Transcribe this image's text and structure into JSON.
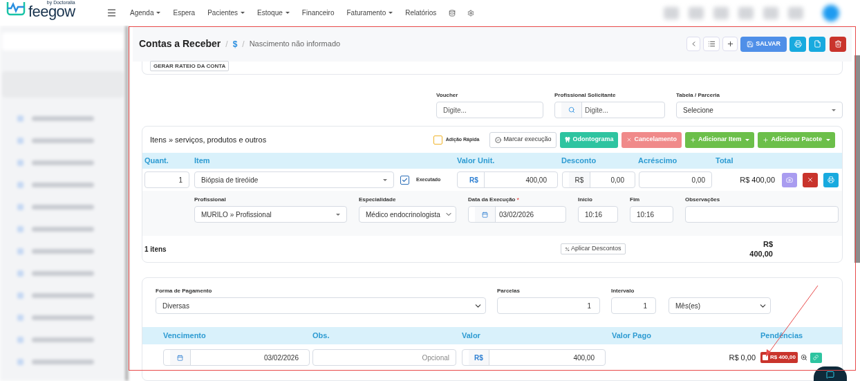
{
  "brand": {
    "name": "feegow",
    "tagline": "by Doctoralia"
  },
  "nav": [
    {
      "label": "Agenda",
      "dropdown": true
    },
    {
      "label": "Espera",
      "dropdown": false
    },
    {
      "label": "Pacientes",
      "dropdown": true
    },
    {
      "label": "Estoque",
      "dropdown": true
    },
    {
      "label": "Financeiro",
      "dropdown": false
    },
    {
      "label": "Faturamento",
      "dropdown": true
    },
    {
      "label": "Relatórios",
      "dropdown": false
    }
  ],
  "header": {
    "title": "Contas a Receber",
    "separators": [
      "/",
      "/"
    ],
    "symbol": "$",
    "subtitle": "Nascimento não informado",
    "save_label": "SALVAR"
  },
  "rateio_button": "GERAR RATEIO DA CONTA",
  "top_fields": [
    {
      "kind": "text",
      "label": "Voucher",
      "placeholder": "Digite..."
    },
    {
      "kind": "search",
      "label": "Profissional Solicitante",
      "placeholder": "Digite..."
    },
    {
      "kind": "select",
      "label": "Tabela / Parceria",
      "value": "Selecione"
    }
  ],
  "items": {
    "title": "Itens » serviços, produtos e outros",
    "quick_add": {
      "label": "Adição Rápida",
      "checked": false
    },
    "buttons": [
      {
        "kind": "outline",
        "label": "Marcar execução"
      },
      {
        "kind": "teal",
        "label": "Odontograma"
      },
      {
        "kind": "cancel",
        "label": "Cancelamento"
      },
      {
        "kind": "add",
        "label": "Adicionar Item"
      },
      {
        "kind": "add",
        "label": "Adicionar Pacote"
      }
    ],
    "columns": [
      "Quant.",
      "Item",
      "Valor Unit.",
      "Desconto",
      "Acréscimo",
      "Total"
    ],
    "rows": [
      {
        "quantity": "1",
        "item": "Biópsia de tireóide",
        "executed": {
          "label": "Executado",
          "checked": true
        },
        "currency": "R$",
        "unit_value": "400,00",
        "discount_currency": "R$",
        "discount": "0,00",
        "surcharge": "0,00",
        "total": "R$ 400,00"
      }
    ],
    "details": {
      "professional": {
        "label": "Profissional",
        "value": "MURILO » Profissional"
      },
      "specialty": {
        "label": "Especialidade",
        "value": "Médico endocrinologista"
      },
      "date": {
        "label": "Data da Execução",
        "required_mark": "*",
        "value": "03/02/2026"
      },
      "start": {
        "label": "Início",
        "value": "10:16"
      },
      "end": {
        "label": "Fim",
        "value": "10:16"
      },
      "notes": {
        "label": "Observações"
      }
    },
    "count": "1 itens",
    "discount_button": "Aplicar Descontos",
    "total": "R$ 400,00"
  },
  "payment": {
    "method": {
      "label": "Forma de Pagamento",
      "value": "Diversas"
    },
    "installments": {
      "label": "Parcelas",
      "value": "1"
    },
    "interval": {
      "label": "Intervalo",
      "value": "1",
      "unit": "Mês(es)"
    },
    "columns": [
      "Vencimento",
      "Obs.",
      "Valor",
      "Valor Pago",
      "Pendências"
    ],
    "rows": [
      {
        "due": "03/02/2026",
        "obs_placeholder": "Opcional",
        "currency": "R$",
        "value": "400,00",
        "paid": "R$ 0,00",
        "pending": "R$ 400,00",
        "pending_checked": false
      }
    ]
  }
}
